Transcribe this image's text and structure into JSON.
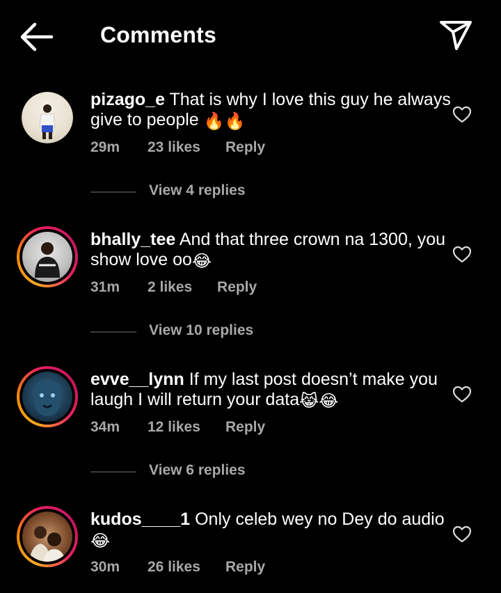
{
  "header": {
    "title": "Comments",
    "back_icon": "arrow-left-icon",
    "share_icon": "paper-plane-icon"
  },
  "colors": {
    "background": "#000000",
    "text": "#ffffff",
    "secondary": "#a8a8a8",
    "ring_start": "#f9a825",
    "ring_end": "#e91e63"
  },
  "comments": [
    {
      "username": "pizago_e",
      "text": "That is why I love this guy he always give to people",
      "emoji": "🔥🔥",
      "time": "29m",
      "likes": "23 likes",
      "reply": "Reply",
      "view_replies": "View 4 replies",
      "has_story_ring": false
    },
    {
      "username": "bhally_tee",
      "text": "And that three crown na 1300, you show love oo",
      "emoji": "😂",
      "time": "31m",
      "likes": "2 likes",
      "reply": "Reply",
      "view_replies": "View 10 replies",
      "has_story_ring": true
    },
    {
      "username": "evve__lynn",
      "text": "If my last post doesn’t make you laugh I will return your data",
      "emoji": "😹😂",
      "time": "34m",
      "likes": "12 likes",
      "reply": "Reply",
      "view_replies": "View 6 replies",
      "has_story_ring": true
    },
    {
      "username": "kudos____1",
      "text": "Only celeb wey no Dey do audio",
      "emoji": "😂",
      "time": "30m",
      "likes": "26 likes",
      "reply": "Reply",
      "has_story_ring": true
    }
  ]
}
